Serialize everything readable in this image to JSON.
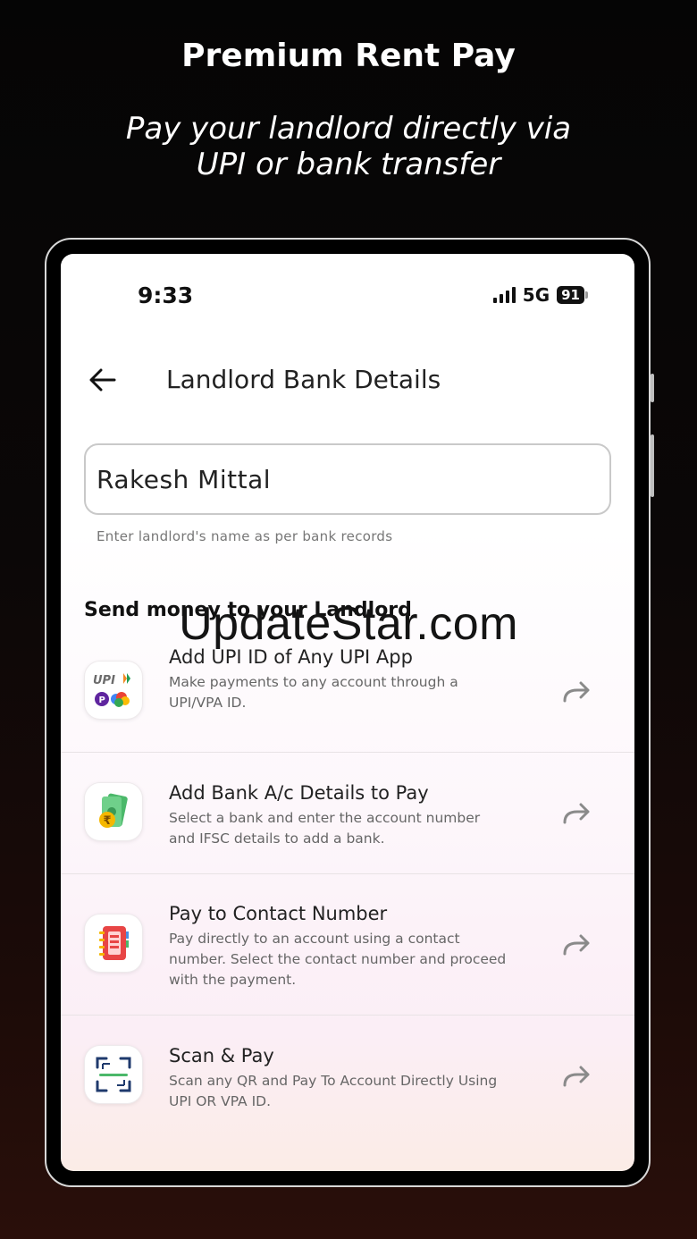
{
  "promo": {
    "title": "Premium Rent Pay",
    "subtitle_line1": "Pay your landlord directly via",
    "subtitle_line2": "UPI or bank transfer"
  },
  "status_bar": {
    "time": "9:33",
    "network": "5G",
    "battery": "91"
  },
  "header": {
    "title": "Landlord Bank Details"
  },
  "landlord_name": {
    "value": "Rakesh Mittal",
    "helper": "Enter landlord's name as per bank records"
  },
  "section": {
    "heading": "Send money to your Landlord"
  },
  "options": [
    {
      "title": "Add UPI ID of Any UPI App",
      "desc": "Make payments to any account through a UPI/VPA ID.",
      "icon": "upi-apps-icon"
    },
    {
      "title": "Add Bank A/c Details to Pay",
      "desc": "Select a bank and enter the account number and IFSC details to add a bank.",
      "icon": "bank-cash-icon"
    },
    {
      "title": "Pay to Contact Number",
      "desc": "Pay directly to an account using a contact number. Select the contact number and proceed with the payment.",
      "icon": "contact-book-icon"
    },
    {
      "title": "Scan & Pay",
      "desc": "Scan any QR and Pay To Account Directly Using UPI OR VPA ID.",
      "icon": "qr-scan-icon"
    }
  ],
  "upi_logo_text": "UPI",
  "rupee_symbol": "₹",
  "watermark": "UpdateStar.com",
  "colors": {
    "accent_purple": "#5f259f",
    "upi_gray": "#6b6b6b",
    "cash_green": "#4bb86a",
    "coin_gold": "#f5b700",
    "contact_red": "#e84545",
    "qr_blue": "#1f3a6d",
    "arrow_gray": "#8a8a8a"
  }
}
